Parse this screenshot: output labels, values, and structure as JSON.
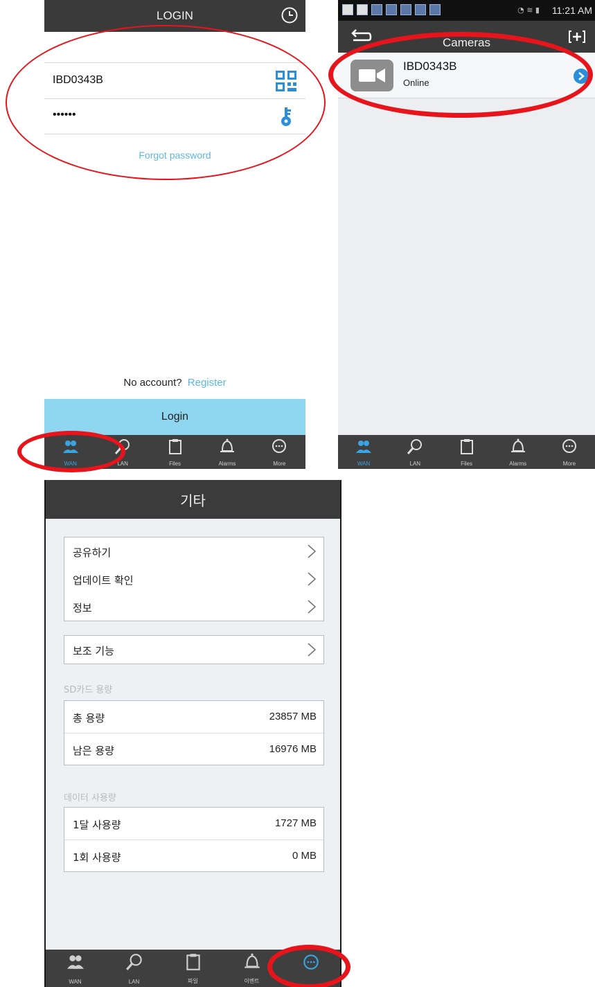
{
  "login": {
    "title": "LOGIN",
    "username": "IBD0343B",
    "password_masked": "••••••",
    "forgot_password": "Forgot password",
    "no_account": "No account?",
    "register": "Register",
    "login_button": "Login",
    "tabs": [
      {
        "label": "WAN",
        "icon": "users-icon"
      },
      {
        "label": "LAN",
        "icon": "search-icon"
      },
      {
        "label": "Files",
        "icon": "clipboard-icon"
      },
      {
        "label": "Alarms",
        "icon": "bell-icon"
      },
      {
        "label": "More",
        "icon": "more-icon"
      }
    ]
  },
  "cameras": {
    "status_time": "11:21 AM",
    "title": "Cameras",
    "camera": {
      "name": "IBD0343B",
      "status": "Online"
    },
    "tabs": [
      {
        "label": "WAN",
        "icon": "users-icon"
      },
      {
        "label": "LAN",
        "icon": "search-icon"
      },
      {
        "label": "Files",
        "icon": "clipboard-icon"
      },
      {
        "label": "Alarms",
        "icon": "bell-icon"
      },
      {
        "label": "More",
        "icon": "more-icon"
      }
    ]
  },
  "more_kr": {
    "title": "기타",
    "menu": [
      "공유하기",
      "업데이트 확인",
      "정보"
    ],
    "accessibility": "보조 기능",
    "sd_section": "SD카드 용량",
    "sd": [
      {
        "label": "총 용량",
        "value": "23857 MB"
      },
      {
        "label": "남은 용량",
        "value": "16976 MB"
      }
    ],
    "data_section": "데이터 사용량",
    "data": [
      {
        "label": "1달 사용량",
        "value": "1727 MB"
      },
      {
        "label": "1회 사용량",
        "value": "0 MB"
      }
    ],
    "tabs": [
      {
        "label": "WAN",
        "icon": "users-icon"
      },
      {
        "label": "LAN",
        "icon": "search-icon"
      },
      {
        "label": "파일",
        "icon": "clipboard-icon"
      },
      {
        "label": "이벤트",
        "icon": "bell-icon"
      },
      {
        "label": "",
        "icon": "more-icon"
      }
    ]
  },
  "colors": {
    "accent": "#5bb8df",
    "login_button": "#8fd6f0",
    "highlight": "#e8141b",
    "bar": "#3a3a3a"
  }
}
